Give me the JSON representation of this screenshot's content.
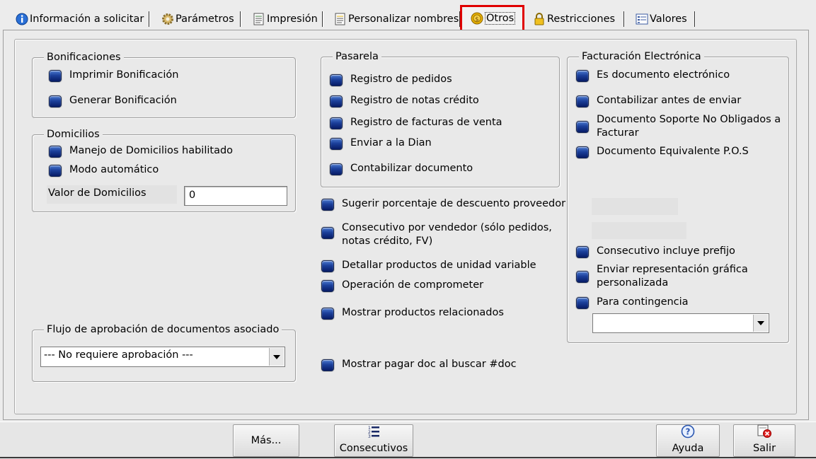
{
  "tabs": [
    {
      "label": "Información a solicitar",
      "icon": "info-icon"
    },
    {
      "label": "Parámetros",
      "icon": "gear-icon"
    },
    {
      "label": "Impresión",
      "icon": "document-icon"
    },
    {
      "label": "Personalizar nombres",
      "icon": "document-edit-icon"
    },
    {
      "label": "Otros",
      "icon": "coin-icon",
      "active": true
    },
    {
      "label": "Restricciones",
      "icon": "lock-icon"
    },
    {
      "label": "Valores",
      "icon": "list-icon"
    }
  ],
  "bonificaciones": {
    "title": "Bonificaciones",
    "items": [
      "Imprimir Bonificación",
      "Generar Bonificación"
    ]
  },
  "domicilios": {
    "title": "Domicilios",
    "items": [
      "Manejo de Domicilios habilitado",
      "Modo automático"
    ],
    "valor_label": "Valor de Domicilios",
    "valor_value": "0"
  },
  "flujo": {
    "title": "Flujo de aprobación de documentos asociado",
    "selected": "--- No requiere aprobación ---"
  },
  "pasarela": {
    "title": "Pasarela",
    "items": [
      "Registro de pedidos",
      "Registro de notas crédito",
      "Registro de facturas de venta",
      "Enviar a la Dian",
      "Contabilizar documento"
    ]
  },
  "middle_options": [
    "Sugerir porcentaje de descuento proveedor",
    "Consecutivo por vendedor (sólo pedidos, notas crédito, FV)",
    "Detallar productos de unidad variable",
    "Operación de comprometer",
    "Mostrar productos relacionados",
    "Mostrar pagar doc al buscar #doc"
  ],
  "facturacion": {
    "title": "Facturación Electrónica",
    "items": [
      "Es documento electrónico",
      "Contabilizar antes de enviar",
      "Documento Soporte No Obligados a Facturar",
      "Documento Equivalente P.O.S"
    ],
    "items_lower": [
      "Consecutivo incluye prefijo",
      "Enviar representación gráfica personalizada",
      "Para contingencia"
    ],
    "contingencia_selected": ""
  },
  "buttons": {
    "mas": "Más...",
    "consecutivos": "Consecutivos",
    "ayuda": "Ayuda",
    "salir": "Salir"
  },
  "colors": {
    "active_tab_outline": "#e00000",
    "checkbox": "#1b3f9a"
  }
}
